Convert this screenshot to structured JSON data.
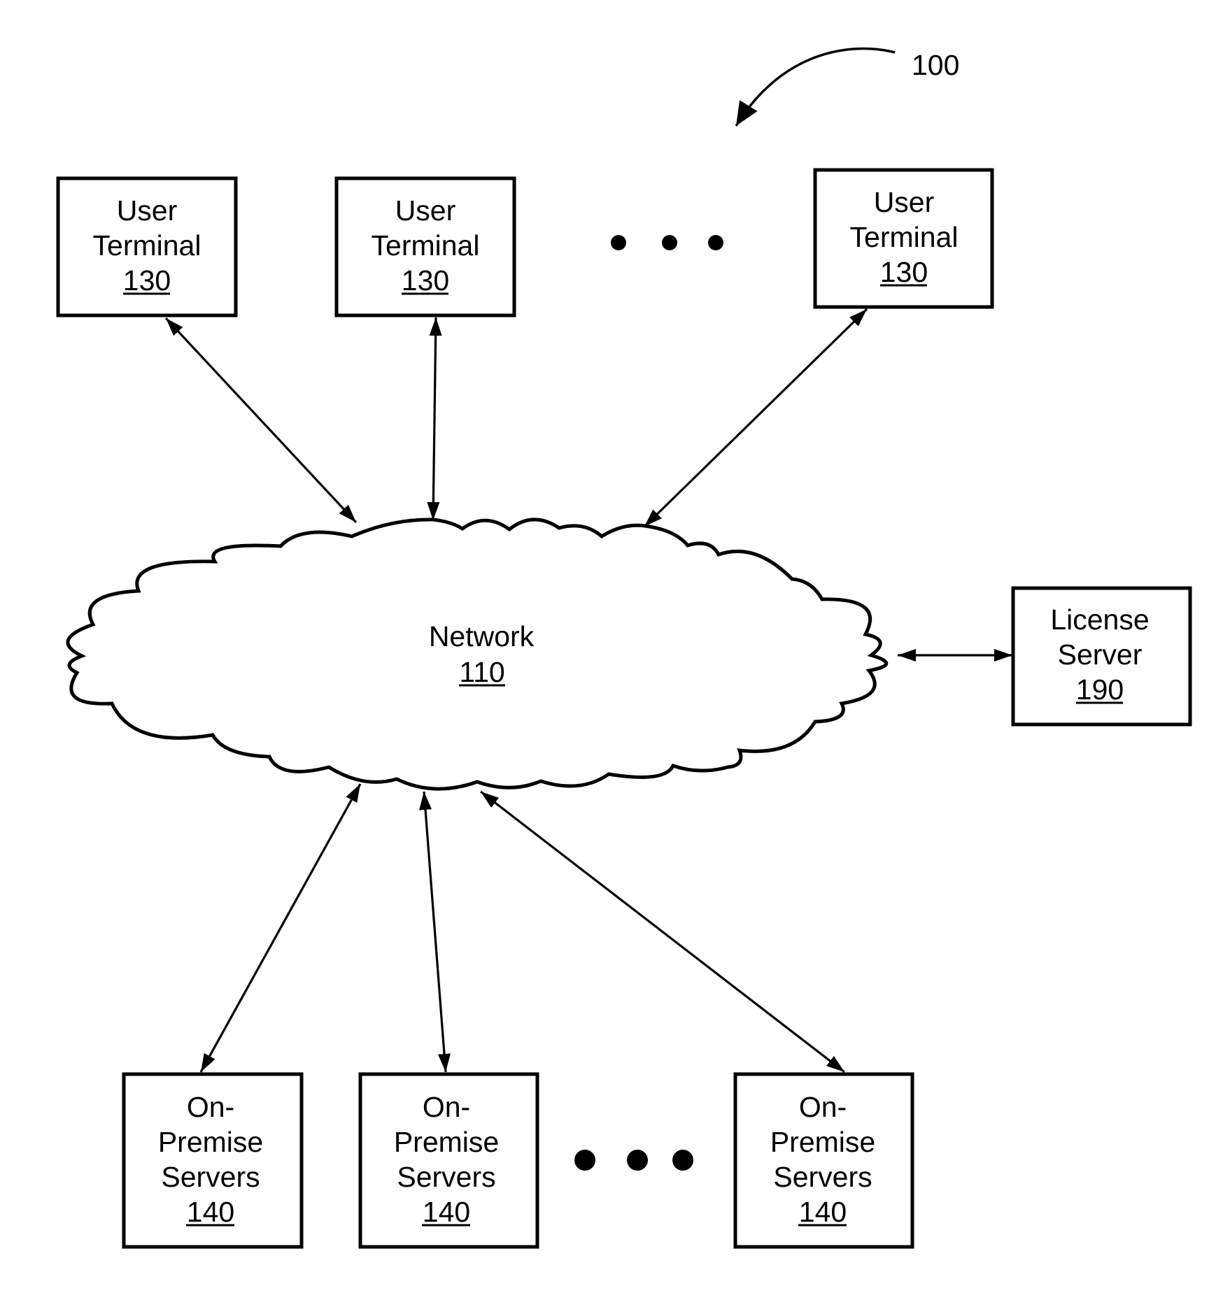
{
  "figure": {
    "reference_label": "100"
  },
  "network": {
    "name": "Network",
    "ref": "110"
  },
  "user_terminals": [
    {
      "lines": [
        "User",
        "Terminal"
      ],
      "ref": "130"
    },
    {
      "lines": [
        "User",
        "Terminal"
      ],
      "ref": "130"
    },
    {
      "lines": [
        "User",
        "Terminal"
      ],
      "ref": "130"
    }
  ],
  "license_server": {
    "lines": [
      "License",
      "Server"
    ],
    "ref": "190"
  },
  "on_premise_servers": [
    {
      "lines": [
        "On-",
        "Premise",
        "Servers"
      ],
      "ref": "140"
    },
    {
      "lines": [
        "On-",
        "Premise",
        "Servers"
      ],
      "ref": "140"
    },
    {
      "lines": [
        "On-",
        "Premise",
        "Servers"
      ],
      "ref": "140"
    }
  ],
  "ellipsis": {
    "terminals": "more user terminals",
    "servers": "more on-premise servers"
  },
  "connections": [
    {
      "from": "user-terminal-1",
      "to": "network",
      "bidirectional": true
    },
    {
      "from": "user-terminal-2",
      "to": "network",
      "bidirectional": true
    },
    {
      "from": "user-terminal-3",
      "to": "network",
      "bidirectional": true
    },
    {
      "from": "network",
      "to": "license-server",
      "bidirectional": true
    },
    {
      "from": "network",
      "to": "on-premise-servers-1",
      "bidirectional": true
    },
    {
      "from": "network",
      "to": "on-premise-servers-2",
      "bidirectional": true
    },
    {
      "from": "network",
      "to": "on-premise-servers-3",
      "bidirectional": true
    }
  ]
}
